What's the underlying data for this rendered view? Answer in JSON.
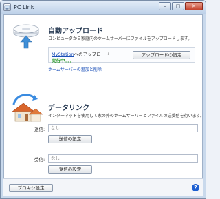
{
  "window": {
    "title": "PC Link",
    "buttons": {
      "minimize": "–",
      "maximize": "□",
      "close": "✕"
    }
  },
  "auto_upload": {
    "heading": "自動アップロード",
    "description": "コンピュータから家庭内のホームサーバーにファイルをアップロードします。",
    "status": {
      "server_name": "MyStation",
      "server_suffix": "へのアップロード",
      "state": "実行中．．．",
      "settings_button": "アップロードの設定"
    },
    "add_remove_link": "ホームサーバーの追加と削除"
  },
  "data_link": {
    "heading": "データリンク",
    "description": "インターネットを使用して家の外のホームサーバーとファイルの送受信を行います。",
    "send": {
      "label": "送信:",
      "value": "なし",
      "button": "送信の設定"
    },
    "receive": {
      "label": "受信:",
      "value": "なし",
      "button": "受信の設定"
    }
  },
  "footer": {
    "proxy_button": "プロキシ設定",
    "help_icon_text": "?"
  },
  "colors": {
    "link": "#1a4fb8",
    "running_status": "#2e9a2e",
    "help_icon": "#1d5fd1"
  }
}
